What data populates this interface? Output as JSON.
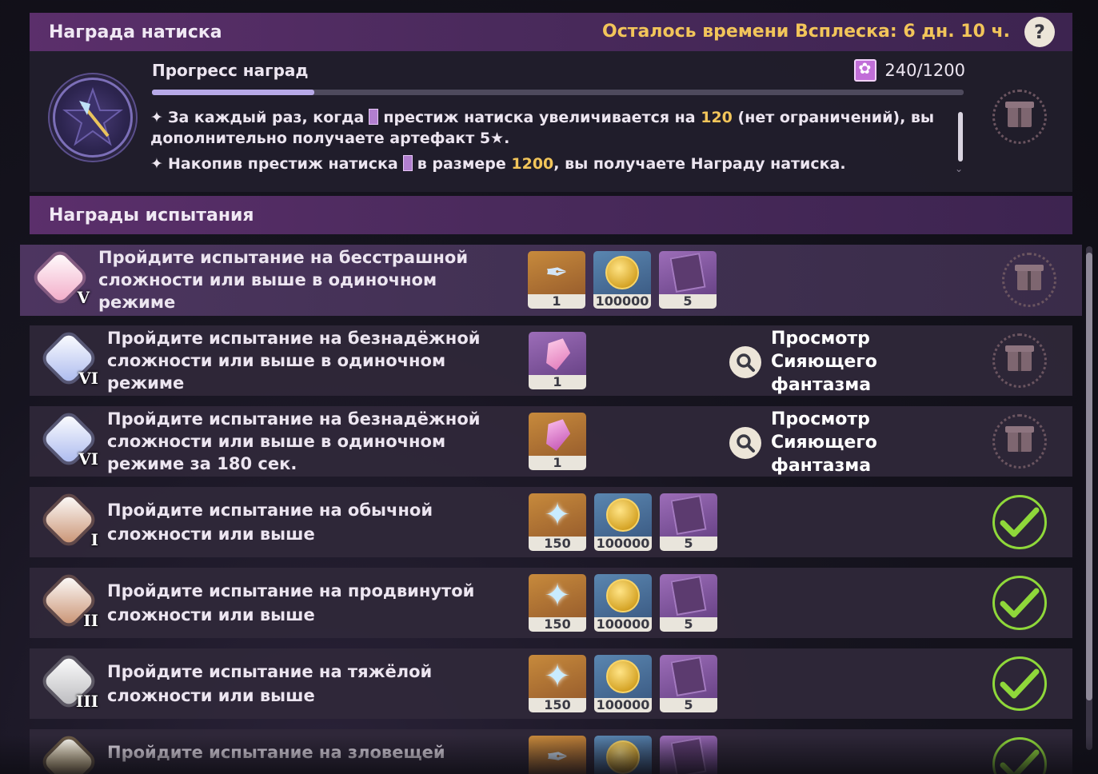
{
  "header": {
    "title": "Награда натиска",
    "timer": "Осталось времени Всплеска: 6 дн. 10 ч.",
    "help_label": "?"
  },
  "progress": {
    "title": "Прогресс наград",
    "count": "240/1200",
    "fraction": 0.2,
    "rule1_a": "За каждый раз, когда",
    "rule1_b": "престиж натиска увеличивается на",
    "rule1_hl": "120",
    "rule1_c": "(нет ограничений), вы дополнительно получаете артефакт 5★.",
    "rule2_a": "Накопив престиж натиска",
    "rule2_b": "в размере",
    "rule2_hl": "1200",
    "rule2_c": ", вы получаете Награду натиска."
  },
  "trial_header": {
    "title": "Награды испытания"
  },
  "rows": [
    {
      "text": "Пройдите испытание на бесстрашной сложности или выше в одиночном режиме",
      "tier": "V",
      "emblem_color": "#f2a9c6",
      "rewards": [
        {
          "icon": "quill-icon",
          "qty": "1"
        },
        {
          "icon": "mora-coin-icon",
          "qty": "100000"
        },
        {
          "icon": "book-icon",
          "qty": "5"
        }
      ],
      "state": "locked"
    },
    {
      "text": "Пройдите испытание на безнадёжной сложности или выше в одиночном режиме",
      "tier": "VI",
      "emblem_color": "#a9b8ee",
      "rewards": [
        {
          "icon": "crystal-icon",
          "qty": "1"
        }
      ],
      "view_label": "Просмотр Сияющего фантазма",
      "state": "locked"
    },
    {
      "text": "Пройдите испытание на безнадёжной сложности или выше в одиночном режиме за 180 сек.",
      "tier": "VI",
      "emblem_color": "#a9b8ee",
      "rewards": [
        {
          "icon": "flame-crystal-icon",
          "qty": "1"
        }
      ],
      "view_label": "Просмотр Сияющего фантазма",
      "state": "locked"
    },
    {
      "text": "Пройдите испытание на обычной сложности или выше",
      "tier": "I",
      "emblem_color": "#c8906f",
      "rewards": [
        {
          "icon": "primogem-icon",
          "qty": "150"
        },
        {
          "icon": "mora-coin-icon",
          "qty": "100000"
        },
        {
          "icon": "book-icon",
          "qty": "5"
        }
      ],
      "state": "claimed"
    },
    {
      "text": "Пройдите испытание на продвинутой сложности или выше",
      "tier": "II",
      "emblem_color": "#c8906f",
      "rewards": [
        {
          "icon": "primogem-icon",
          "qty": "150"
        },
        {
          "icon": "mora-coin-icon",
          "qty": "100000"
        },
        {
          "icon": "book-icon",
          "qty": "5"
        }
      ],
      "state": "claimed"
    },
    {
      "text": "Пройдите испытание на тяжёлой сложности или выше",
      "tier": "III",
      "emblem_color": "#b9b9bd",
      "rewards": [
        {
          "icon": "primogem-icon",
          "qty": "150"
        },
        {
          "icon": "mora-coin-icon",
          "qty": "100000"
        },
        {
          "icon": "book-icon",
          "qty": "5"
        }
      ],
      "state": "claimed"
    },
    {
      "text": "Пройдите испытание на зловещей",
      "tier": "",
      "emblem_color": "#e6c063",
      "rewards": [
        {
          "icon": "quill-icon",
          "qty": ""
        },
        {
          "icon": "mora-coin-icon",
          "qty": ""
        },
        {
          "icon": "book-icon",
          "qty": ""
        }
      ],
      "state": "claimed"
    }
  ],
  "colors": {
    "accent_gold": "#f2c55a",
    "header_purple": "#5b2f6b",
    "claimed_green": "#8fd83a"
  }
}
